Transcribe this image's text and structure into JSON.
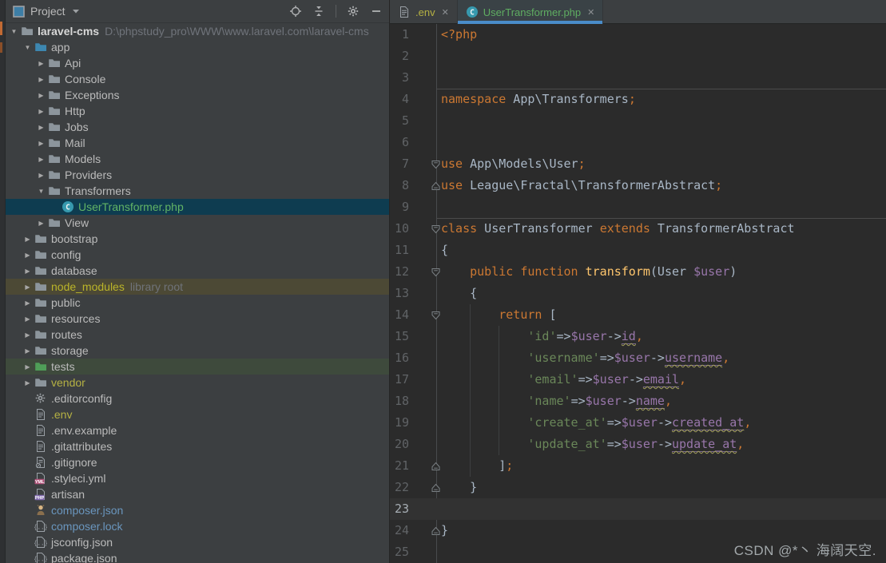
{
  "colors": {
    "panel_bg": "#3C3F41",
    "editor_bg": "#2B2B2B",
    "tab_underline": "#4A8CC9",
    "selection_bg": "#0E3C50",
    "node_modules_bg": "#4C4935",
    "tests_bg": "#3E4A3C",
    "keyword": "#CC7832",
    "string": "#6A8759",
    "variable": "#9876AA",
    "function": "#FFC66D",
    "plain": "#A9B7C6"
  },
  "project_panel": {
    "title": "Project",
    "toolbar_icons": [
      {
        "name": "locate-icon"
      },
      {
        "name": "collapse-all-icon"
      },
      {
        "name": "divider"
      },
      {
        "name": "settings-gear-icon"
      },
      {
        "name": "hide-icon"
      }
    ]
  },
  "tabs": [
    {
      "label": ".env",
      "icon": "text-file-icon",
      "active": false,
      "label_color": "#B5B143",
      "close": "✕"
    },
    {
      "label": "UserTransformer.php",
      "icon": "php-class-icon",
      "active": true,
      "label_color": "#5FAD61",
      "close": "✕"
    }
  ],
  "tree": [
    {
      "label": "laravel-cms",
      "suffix": "D:\\phpstudy_pro\\WWW\\www.laravel.com\\laravel-cms",
      "level": 0,
      "arrow": "open",
      "icon": "folder-icon",
      "icon_color": "#8C959C",
      "bold": true
    },
    {
      "label": "app",
      "level": 1,
      "arrow": "open",
      "icon": "folder-icon",
      "icon_color": "#3D87B0"
    },
    {
      "label": "Api",
      "level": 2,
      "arrow": "closed",
      "icon": "folder-icon",
      "icon_color": "#8C959C"
    },
    {
      "label": "Console",
      "level": 2,
      "arrow": "closed",
      "icon": "folder-icon",
      "icon_color": "#8C959C"
    },
    {
      "label": "Exceptions",
      "level": 2,
      "arrow": "closed",
      "icon": "folder-icon",
      "icon_color": "#8C959C"
    },
    {
      "label": "Http",
      "level": 2,
      "arrow": "closed",
      "icon": "folder-icon",
      "icon_color": "#8C959C"
    },
    {
      "label": "Jobs",
      "level": 2,
      "arrow": "closed",
      "icon": "folder-icon",
      "icon_color": "#8C959C"
    },
    {
      "label": "Mail",
      "level": 2,
      "arrow": "closed",
      "icon": "folder-icon",
      "icon_color": "#8C959C"
    },
    {
      "label": "Models",
      "level": 2,
      "arrow": "closed",
      "icon": "folder-icon",
      "icon_color": "#8C959C"
    },
    {
      "label": "Providers",
      "level": 2,
      "arrow": "closed",
      "icon": "folder-icon",
      "icon_color": "#8C959C"
    },
    {
      "label": "Transformers",
      "level": 2,
      "arrow": "open",
      "icon": "folder-icon",
      "icon_color": "#8C959C"
    },
    {
      "label": "UserTransformer.php",
      "level": 3,
      "arrow": "none",
      "icon": "php-class-icon",
      "label_color": "#61B365",
      "row_bg": "selected"
    },
    {
      "label": "View",
      "level": 2,
      "arrow": "closed",
      "icon": "folder-icon",
      "icon_color": "#8C959C"
    },
    {
      "label": "bootstrap",
      "level": 1,
      "arrow": "closed",
      "icon": "folder-icon",
      "icon_color": "#8C959C"
    },
    {
      "label": "config",
      "level": 1,
      "arrow": "closed",
      "icon": "folder-icon",
      "icon_color": "#8C959C"
    },
    {
      "label": "database",
      "level": 1,
      "arrow": "closed",
      "icon": "folder-icon",
      "icon_color": "#8C959C"
    },
    {
      "label": "node_modules",
      "suffix": "library root",
      "level": 1,
      "arrow": "closed",
      "icon": "folder-icon",
      "icon_color": "#8C959C",
      "label_color": "#BBB529",
      "row_bg": "olive"
    },
    {
      "label": "public",
      "level": 1,
      "arrow": "closed",
      "icon": "folder-icon",
      "icon_color": "#8C959C"
    },
    {
      "label": "resources",
      "level": 1,
      "arrow": "closed",
      "icon": "folder-icon",
      "icon_color": "#8C959C"
    },
    {
      "label": "routes",
      "level": 1,
      "arrow": "closed",
      "icon": "folder-icon",
      "icon_color": "#8C959C"
    },
    {
      "label": "storage",
      "level": 1,
      "arrow": "closed",
      "icon": "folder-icon",
      "icon_color": "#8C959C"
    },
    {
      "label": "tests",
      "level": 1,
      "arrow": "closed",
      "icon": "folder-icon",
      "icon_color": "#4F9E58",
      "row_bg": "green"
    },
    {
      "label": "vendor",
      "level": 1,
      "arrow": "closed",
      "icon": "folder-icon",
      "icon_color": "#8C959C",
      "label_color": "#B5B143"
    },
    {
      "label": ".editorconfig",
      "level": 1,
      "arrow": "none",
      "icon": "gear-icon"
    },
    {
      "label": ".env",
      "level": 1,
      "arrow": "none",
      "icon": "text-file-icon",
      "label_color": "#B5B143"
    },
    {
      "label": ".env.example",
      "level": 1,
      "arrow": "none",
      "icon": "text-file-icon"
    },
    {
      "label": ".gitattributes",
      "level": 1,
      "arrow": "none",
      "icon": "text-file-icon"
    },
    {
      "label": ".gitignore",
      "level": 1,
      "arrow": "none",
      "icon": "ignored-file-icon"
    },
    {
      "label": ".styleci.yml",
      "level": 1,
      "arrow": "none",
      "icon": "yml-file-icon"
    },
    {
      "label": "artisan",
      "level": 1,
      "arrow": "none",
      "icon": "php-file-icon"
    },
    {
      "label": "composer.json",
      "level": 1,
      "arrow": "none",
      "icon": "composer-icon",
      "label_color": "#6A96BE"
    },
    {
      "label": "composer.lock",
      "level": 1,
      "arrow": "none",
      "icon": "json-file-icon",
      "label_color": "#6A96BE"
    },
    {
      "label": "jsconfig.json",
      "level": 1,
      "arrow": "none",
      "icon": "json-file-icon"
    },
    {
      "label": "package.json",
      "level": 1,
      "arrow": "none",
      "icon": "json-file-icon"
    }
  ],
  "editor": {
    "watermark": "CSDN @*丶 海阔天空.",
    "lines": [
      {
        "n": 1,
        "seg": [
          [
            "kw",
            "<?php"
          ]
        ]
      },
      {
        "n": 2,
        "seg": []
      },
      {
        "n": 3,
        "seg": []
      },
      {
        "n": 4,
        "sep": true,
        "seg": [
          [
            "kw",
            "namespace"
          ],
          [
            "pl",
            " App\\Transformers"
          ],
          [
            "pu",
            ";"
          ]
        ]
      },
      {
        "n": 5,
        "seg": []
      },
      {
        "n": 6,
        "seg": []
      },
      {
        "n": 7,
        "fold": "down",
        "seg": [
          [
            "kw",
            "use"
          ],
          [
            "pl",
            " App\\Models\\User"
          ],
          [
            "pu",
            ";"
          ]
        ]
      },
      {
        "n": 8,
        "fold": "up",
        "seg": [
          [
            "kw",
            "use"
          ],
          [
            "pl",
            " League\\Fractal\\TransformerAbstract"
          ],
          [
            "pu",
            ";"
          ]
        ]
      },
      {
        "n": 9,
        "seg": []
      },
      {
        "n": 10,
        "sep": true,
        "fold": "down",
        "seg": [
          [
            "kw",
            "class"
          ],
          [
            "pl",
            " UserTransformer "
          ],
          [
            "kw",
            "extends"
          ],
          [
            "pl",
            " TransformerAbstract"
          ]
        ]
      },
      {
        "n": 11,
        "seg": [
          [
            "pl",
            "{"
          ]
        ]
      },
      {
        "n": 12,
        "fold": "down",
        "seg": [
          [
            "pl",
            "    "
          ],
          [
            "kw",
            "public"
          ],
          [
            "pl",
            " "
          ],
          [
            "kw",
            "function"
          ],
          [
            "pl",
            " "
          ],
          [
            "fn",
            "transform"
          ],
          [
            "pl",
            "(User "
          ],
          [
            "vr",
            "$user"
          ],
          [
            "pl",
            ")"
          ]
        ]
      },
      {
        "n": 13,
        "seg": [
          [
            "pl",
            "    {"
          ]
        ]
      },
      {
        "n": 14,
        "fold": "down",
        "seg": [
          [
            "pl",
            "        "
          ],
          [
            "kw",
            "return"
          ],
          [
            "pl",
            " ["
          ]
        ]
      },
      {
        "n": 15,
        "seg": [
          [
            "pl",
            "            "
          ],
          [
            "st",
            "'id'"
          ],
          [
            "pl",
            "=>"
          ],
          [
            "vr",
            "$user"
          ],
          [
            "pl",
            "->"
          ],
          [
            "pr",
            "id"
          ],
          [
            "pu",
            ","
          ]
        ]
      },
      {
        "n": 16,
        "seg": [
          [
            "pl",
            "            "
          ],
          [
            "st",
            "'username'"
          ],
          [
            "pl",
            "=>"
          ],
          [
            "vr",
            "$user"
          ],
          [
            "pl",
            "->"
          ],
          [
            "pr",
            "username"
          ],
          [
            "pu",
            ","
          ]
        ]
      },
      {
        "n": 17,
        "seg": [
          [
            "pl",
            "            "
          ],
          [
            "st",
            "'email'"
          ],
          [
            "pl",
            "=>"
          ],
          [
            "vr",
            "$user"
          ],
          [
            "pl",
            "->"
          ],
          [
            "pr",
            "email"
          ],
          [
            "pu",
            ","
          ]
        ]
      },
      {
        "n": 18,
        "seg": [
          [
            "pl",
            "            "
          ],
          [
            "st",
            "'name'"
          ],
          [
            "pl",
            "=>"
          ],
          [
            "vr",
            "$user"
          ],
          [
            "pl",
            "->"
          ],
          [
            "pr",
            "name"
          ],
          [
            "pu",
            ","
          ]
        ]
      },
      {
        "n": 19,
        "seg": [
          [
            "pl",
            "            "
          ],
          [
            "st",
            "'create_at'"
          ],
          [
            "pl",
            "=>"
          ],
          [
            "vr",
            "$user"
          ],
          [
            "pl",
            "->"
          ],
          [
            "pr",
            "created_at"
          ],
          [
            "pu",
            ","
          ]
        ]
      },
      {
        "n": 20,
        "seg": [
          [
            "pl",
            "            "
          ],
          [
            "st",
            "'update_at'"
          ],
          [
            "pl",
            "=>"
          ],
          [
            "vr",
            "$user"
          ],
          [
            "pl",
            "->"
          ],
          [
            "pr",
            "update_at"
          ],
          [
            "pu",
            ","
          ]
        ]
      },
      {
        "n": 21,
        "fold": "up",
        "seg": [
          [
            "pl",
            "        ]"
          ],
          [
            "pu",
            ";"
          ]
        ]
      },
      {
        "n": 22,
        "fold": "up",
        "seg": [
          [
            "pl",
            "    }"
          ]
        ]
      },
      {
        "n": 23,
        "current": true,
        "seg": []
      },
      {
        "n": 24,
        "fold": "up",
        "seg": [
          [
            "pl",
            "}"
          ]
        ]
      },
      {
        "n": 25,
        "seg": []
      }
    ]
  }
}
